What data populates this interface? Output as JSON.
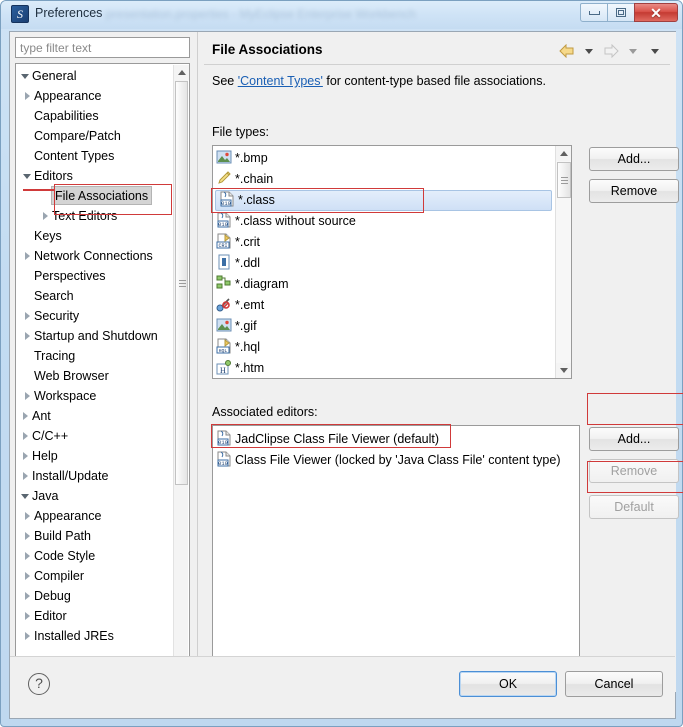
{
  "window": {
    "title": "Preferences",
    "ghost_title": "presentation.properties - MyEclipse Enterprise Workbench",
    "icon": "eclipse-logo-icon",
    "controls": {
      "minimize": "minimize-icon",
      "maximize": "maximize-icon",
      "close": "✕"
    }
  },
  "sidebar": {
    "filter": {
      "placeholder": "type filter text",
      "value": ""
    },
    "items": [
      {
        "label": "General",
        "indent": 0,
        "state": "expanded",
        "selected": false
      },
      {
        "label": "Appearance",
        "indent": 1,
        "state": "collapsed",
        "selected": false
      },
      {
        "label": "Capabilities",
        "indent": 1,
        "state": "leaf",
        "selected": false
      },
      {
        "label": "Compare/Patch",
        "indent": 1,
        "state": "leaf",
        "selected": false
      },
      {
        "label": "Content Types",
        "indent": 1,
        "state": "leaf",
        "selected": false
      },
      {
        "label": "Editors",
        "indent": 1,
        "state": "expanded",
        "selected": false
      },
      {
        "label": "File Associations",
        "indent": 2,
        "state": "leaf",
        "selected": true
      },
      {
        "label": "Text Editors",
        "indent": 2,
        "state": "collapsed",
        "selected": false
      },
      {
        "label": "Keys",
        "indent": 1,
        "state": "leaf",
        "selected": false
      },
      {
        "label": "Network Connections",
        "indent": 1,
        "state": "collapsed",
        "selected": false
      },
      {
        "label": "Perspectives",
        "indent": 1,
        "state": "leaf",
        "selected": false
      },
      {
        "label": "Search",
        "indent": 1,
        "state": "leaf",
        "selected": false
      },
      {
        "label": "Security",
        "indent": 1,
        "state": "collapsed",
        "selected": false
      },
      {
        "label": "Startup and Shutdown",
        "indent": 1,
        "state": "collapsed",
        "selected": false
      },
      {
        "label": "Tracing",
        "indent": 1,
        "state": "leaf",
        "selected": false
      },
      {
        "label": "Web Browser",
        "indent": 1,
        "state": "leaf",
        "selected": false
      },
      {
        "label": "Workspace",
        "indent": 1,
        "state": "collapsed",
        "selected": false
      },
      {
        "label": "Ant",
        "indent": 0,
        "state": "collapsed",
        "selected": false
      },
      {
        "label": "C/C++",
        "indent": 0,
        "state": "collapsed",
        "selected": false
      },
      {
        "label": "Help",
        "indent": 0,
        "state": "collapsed",
        "selected": false
      },
      {
        "label": "Install/Update",
        "indent": 0,
        "state": "collapsed",
        "selected": false
      },
      {
        "label": "Java",
        "indent": 0,
        "state": "expanded",
        "selected": false
      },
      {
        "label": "Appearance",
        "indent": 1,
        "state": "collapsed",
        "selected": false
      },
      {
        "label": "Build Path",
        "indent": 1,
        "state": "collapsed",
        "selected": false
      },
      {
        "label": "Code Style",
        "indent": 1,
        "state": "collapsed",
        "selected": false
      },
      {
        "label": "Compiler",
        "indent": 1,
        "state": "collapsed",
        "selected": false
      },
      {
        "label": "Debug",
        "indent": 1,
        "state": "collapsed",
        "selected": false
      },
      {
        "label": "Editor",
        "indent": 1,
        "state": "collapsed",
        "selected": false
      },
      {
        "label": "Installed JREs",
        "indent": 1,
        "state": "collapsed",
        "selected": false
      }
    ]
  },
  "page": {
    "title": "File Associations",
    "nav": {
      "back": "back-arrow-icon",
      "back_menu": "chevron-down-icon",
      "forward": "forward-arrow-icon",
      "forward_menu": "chevron-down-icon",
      "menu": "chevron-down-icon"
    },
    "description": {
      "prefix": "See ",
      "link": "'Content Types'",
      "suffix": " for content-type based file associations."
    },
    "file_types_label": "File types:",
    "file_types": [
      {
        "name": "*.bmp",
        "icon": "image-file-icon",
        "selected": false
      },
      {
        "name": "*.chain",
        "icon": "pencil-file-icon",
        "selected": false
      },
      {
        "name": "*.class",
        "icon": "class-file-icon",
        "selected": true
      },
      {
        "name": "*.class without source",
        "icon": "class-file-icon",
        "selected": false
      },
      {
        "name": "*.crit",
        "icon": "crit-file-icon",
        "selected": false
      },
      {
        "name": "*.ddl",
        "icon": "ddl-file-icon",
        "selected": false
      },
      {
        "name": "*.diagram",
        "icon": "diagram-file-icon",
        "selected": false
      },
      {
        "name": "*.emt",
        "icon": "emt-file-icon",
        "selected": false
      },
      {
        "name": "*.gif",
        "icon": "image-file-icon",
        "selected": false
      },
      {
        "name": "*.hql",
        "icon": "hql-file-icon",
        "selected": false
      },
      {
        "name": "*.htm",
        "icon": "html-file-icon",
        "selected": false
      }
    ],
    "file_type_buttons": [
      {
        "label": "Add...",
        "enabled": true
      },
      {
        "label": "Remove",
        "enabled": true
      }
    ],
    "associated_editors_label": "Associated editors:",
    "associated_editors": [
      {
        "name": "JadClipse Class File Viewer (default)",
        "icon": "class-file-icon",
        "annotated": true
      },
      {
        "name": "Class File Viewer (locked by 'Java Class File' content type)",
        "icon": "class-file-icon",
        "annotated": false
      }
    ],
    "editor_buttons": [
      {
        "label": "Add...",
        "enabled": true
      },
      {
        "label": "Remove",
        "enabled": false
      },
      {
        "label": "Default",
        "enabled": false
      }
    ]
  },
  "footer": {
    "help": "?",
    "ok_label": "OK",
    "cancel_label": "Cancel"
  },
  "colors": {
    "annotation": "#d03a3a",
    "link": "#1a5fb4",
    "selection": "#cfe0f6",
    "titlebar": "#cfe3f5",
    "close_button": "#c43a32"
  }
}
